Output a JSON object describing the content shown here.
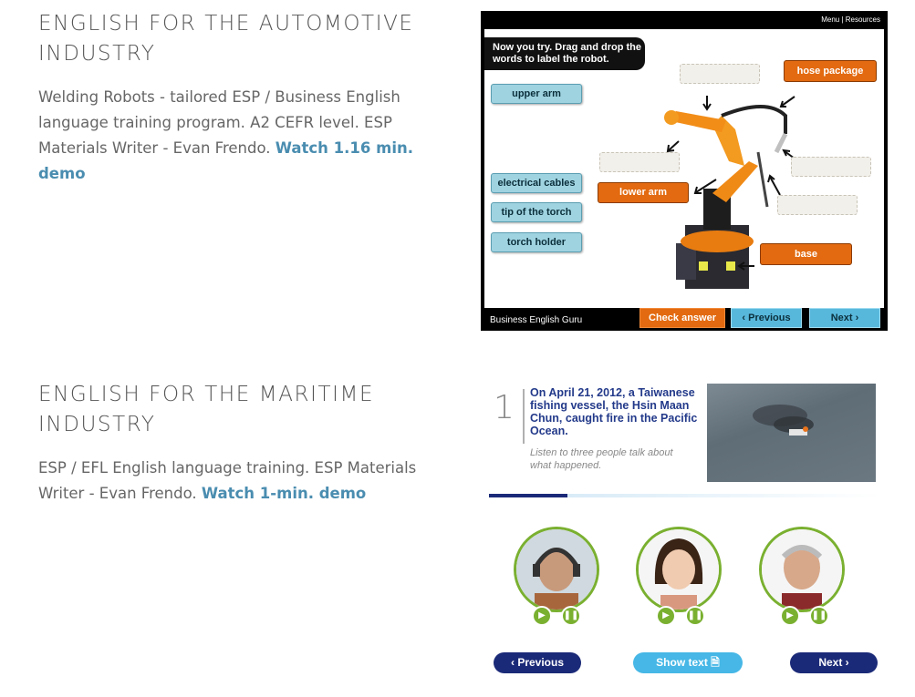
{
  "automotive": {
    "title": "ENGLISH FOR THE AUTOMOTIVE INDUSTRY",
    "description": "Welding Robots - tailored ESP / Business English language training program. A2 CEFR level. ESP Materials Writer - Evan Frendo. ",
    "link": "Watch 1.16 min. demo",
    "demo": {
      "menu": "Menu | Resources",
      "instruction": "Now you try. Drag and drop the words to label the robot.",
      "draggable_labels": [
        "upper arm",
        "electrical cables",
        "tip of the torch",
        "torch holder"
      ],
      "placed_labels": [
        "hose package",
        "lower arm",
        "base"
      ],
      "brand": "Business English Guru",
      "buttons": {
        "check": "Check answer",
        "previous": "Previous",
        "next": "Next"
      }
    }
  },
  "maritime": {
    "title": "ENGLISH FOR THE MARITIME INDUSTRY",
    "description": "ESP / EFL English language training. ESP Materials Writer - Evan Frendo. ",
    "link": "Watch 1-min. demo",
    "demo": {
      "step": "1",
      "headline": "On April 21, 2012, a Taiwanese fishing vessel, the Hsin Maan Chun, caught fire in the Pacific Ocean.",
      "instruction": "Listen to three people talk about what happened.",
      "progress": 0.2,
      "buttons": {
        "previous": "Previous",
        "show_text": "Show text",
        "next": "Next"
      }
    }
  },
  "colors": {
    "link": "#4a8db0",
    "orange": "#e36a10",
    "label_blue": "#9fd3e0",
    "navy": "#1b2a78",
    "sky": "#46b7e6",
    "green": "#7ab030"
  }
}
